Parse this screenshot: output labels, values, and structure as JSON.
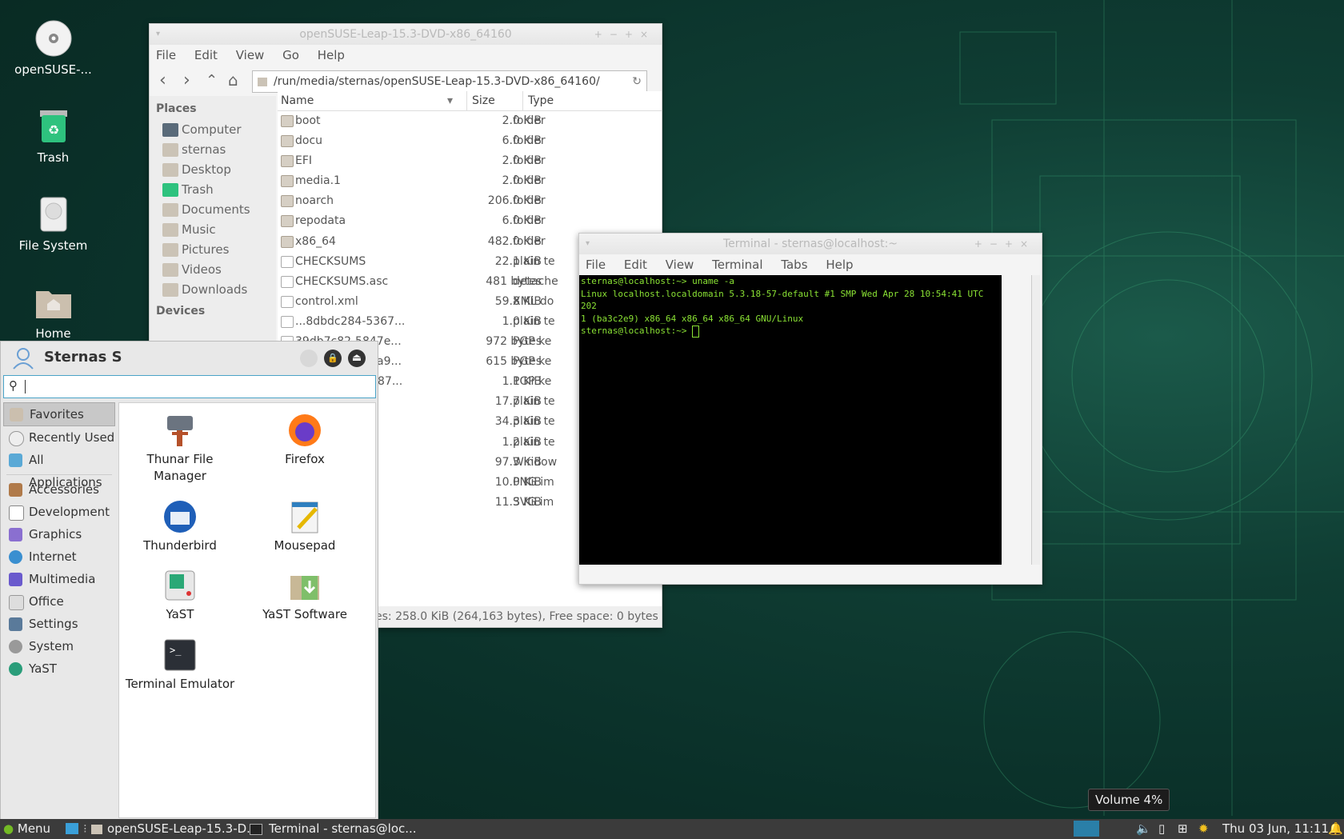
{
  "desktop": {
    "icons": [
      {
        "label": "openSUSE-..."
      },
      {
        "label": "Trash"
      },
      {
        "label": "File System"
      },
      {
        "label": "Home"
      }
    ]
  },
  "thunar": {
    "title": "openSUSE-Leap-15.3-DVD-x86_64160",
    "menu": [
      "File",
      "Edit",
      "View",
      "Go",
      "Help"
    ],
    "path": "/run/media/sternas/openSUSE-Leap-15.3-DVD-x86_64160/",
    "places_header": "Places",
    "places": [
      "Computer",
      "sternas",
      "Desktop",
      "Trash",
      "Documents",
      "Music",
      "Pictures",
      "Videos",
      "Downloads"
    ],
    "devices_header": "Devices",
    "columns": {
      "name": "Name",
      "size": "Size",
      "type": "Type"
    },
    "rows": [
      {
        "name": "boot",
        "size": "2.0 KiB",
        "type": "folder"
      },
      {
        "name": "docu",
        "size": "6.0 KiB",
        "type": "folder"
      },
      {
        "name": "EFI",
        "size": "2.0 KiB",
        "type": "folder"
      },
      {
        "name": "media.1",
        "size": "2.0 KiB",
        "type": "folder"
      },
      {
        "name": "noarch",
        "size": "206.0 KiB",
        "type": "folder"
      },
      {
        "name": "repodata",
        "size": "6.0 KiB",
        "type": "folder"
      },
      {
        "name": "x86_64",
        "size": "482.0 KiB",
        "type": "folder"
      },
      {
        "name": "CHECKSUMS",
        "size": "22.1 KiB",
        "type": "plain te"
      },
      {
        "name": "CHECKSUMS.asc",
        "size": "481 bytes",
        "type": "detache"
      },
      {
        "name": "control.xml",
        "size": "59.8 KiB",
        "type": "XML do"
      },
      {
        "name": "...8dbdc284-5367...",
        "size": "1.0 KiB",
        "type": "plain te"
      },
      {
        "name": "39db7c82-5847e...",
        "size": "972 bytes",
        "type": "PGP ke"
      },
      {
        "name": "307e3d54-5aaa9...",
        "size": "615 bytes",
        "type": "PGP ke"
      },
      {
        "name": "65176565-59787...",
        "size": "1.1 KiB",
        "type": "PGP ke"
      },
      {
        "name": "",
        "size": "17.7 KiB",
        "type": "plain te"
      },
      {
        "name": "",
        "size": "34.3 KiB",
        "type": "plain te"
      },
      {
        "name": "",
        "size": "1.2 KiB",
        "type": "plain te"
      },
      {
        "name": "",
        "size": "97.3 KiB",
        "type": "Window"
      },
      {
        "name": "",
        "size": "10.0 KiB",
        "type": "PNG im"
      },
      {
        "name": "",
        "size": "11.3 KiB",
        "type": "SVG im"
      }
    ],
    "status": "es: 258.0 KiB (264,163 bytes), Free space: 0 bytes"
  },
  "terminal": {
    "title": "Terminal - sternas@localhost:~",
    "menu": [
      "File",
      "Edit",
      "View",
      "Terminal",
      "Tabs",
      "Help"
    ],
    "lines": [
      "sternas@localhost:~> uname -a",
      "Linux localhost.localdomain 5.3.18-57-default #1 SMP Wed Apr 28 10:54:41 UTC 202",
      "1 (ba3c2e9) x86_64 x86_64 x86_64 GNU/Linux",
      "sternas@localhost:~> "
    ]
  },
  "whisker": {
    "user": "Sternas S",
    "search_placeholder": "",
    "categories": [
      "Favorites",
      "Recently Used",
      "All Applications",
      "Accessories",
      "Development",
      "Graphics",
      "Internet",
      "Multimedia",
      "Office",
      "Settings",
      "System",
      "YaST"
    ],
    "apps": [
      {
        "label": "Thunar File Manager"
      },
      {
        "label": "Firefox"
      },
      {
        "label": "Thunderbird"
      },
      {
        "label": "Mousepad"
      },
      {
        "label": "YaST"
      },
      {
        "label": "YaST Software"
      },
      {
        "label": "Terminal Emulator"
      }
    ]
  },
  "panel": {
    "menu_label": "Menu",
    "task1": "openSUSE-Leap-15.3-D...",
    "task2": "Terminal - sternas@loc...",
    "clock": "Thu 03 Jun, 11:11",
    "tooltip": "Volume 4%"
  }
}
